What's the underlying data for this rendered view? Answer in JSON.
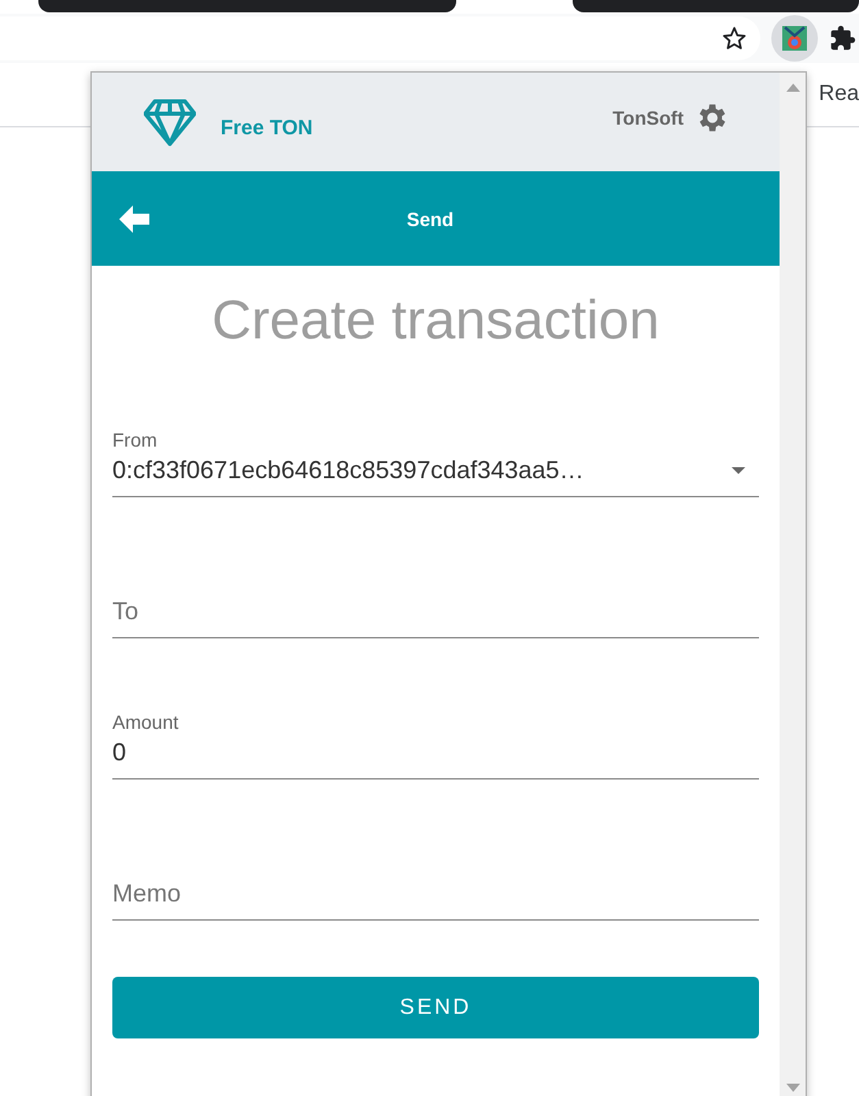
{
  "browser": {
    "bookmark_text": "Rea"
  },
  "popup": {
    "brand": "Free TON",
    "account": "TonSoft",
    "nav_title": "Send",
    "heading": "Create transaction",
    "fields": [
      {
        "kind": "select",
        "label": "From",
        "value": "0:cf33f0671ecb64618c85397cdaf343aa5…"
      },
      {
        "kind": "text",
        "placeholder": "To"
      },
      {
        "kind": "text",
        "label": "Amount",
        "value": "0"
      },
      {
        "kind": "text",
        "placeholder": "Memo"
      }
    ],
    "submit": "SEND"
  }
}
